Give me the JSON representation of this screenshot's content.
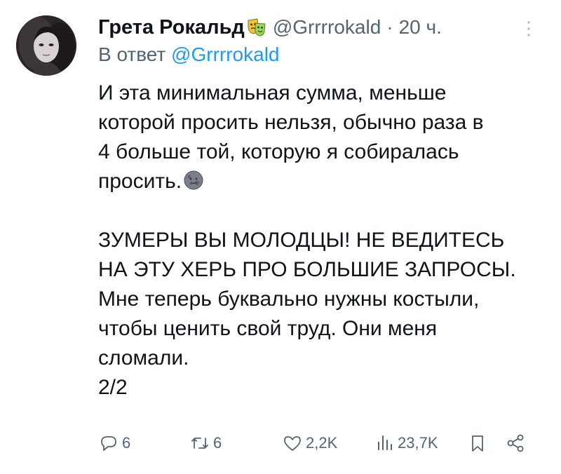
{
  "tweet": {
    "display_name": "Грета Рокальд",
    "name_emoji": "theater-masks-emoji",
    "handle": "@Grrrrokald",
    "separator": "·",
    "time": "20 ч.",
    "reply_prefix": "В ответ",
    "reply_handle": "@Grrrrokald",
    "paragraph_1": "И эта минимальная сумма, меньше\nкоторой просить нельзя, обычно раза в\n4 больше той, которую я собиралась\nпросить.",
    "paragraph_1_emoji": "new-moon-face-emoji",
    "paragraph_2": "ЗУМЕРЫ ВЫ МОЛОДЦЫ! НЕ ВЕДИТЕСЬ\nНА ЭТУ ХЕРЬ ПРО БОЛЬШИЕ ЗАПРОСЫ.\nМне теперь буквально нужны костыли,\nчтобы ценить свой труд. Они меня\nсломали.",
    "paragraph_3": "2/2"
  },
  "actions": {
    "reply_count": "6",
    "retweet_count": "6",
    "like_count": "2,2K",
    "views_count": "23,7K"
  },
  "colors": {
    "text": "#0f1419",
    "secondary": "#536471",
    "link": "#1d9bf0"
  },
  "icons": [
    "more-icon",
    "reply-icon",
    "retweet-icon",
    "like-icon",
    "views-icon",
    "bookmark-icon",
    "share-icon"
  ]
}
